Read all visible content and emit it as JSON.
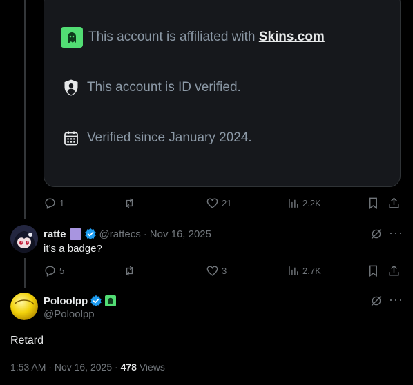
{
  "affiliation_card": {
    "affiliated_text": "This account is affiliated with",
    "affiliated_link": "Skins.com",
    "id_verified_text": "This account is ID verified.",
    "verified_since_text": "Verified since January 2024."
  },
  "post1_actions": {
    "replies": "1",
    "likes": "21",
    "views": "2.2K"
  },
  "reply": {
    "name": "ratte",
    "handle": "@rattecs",
    "separator": "·",
    "date": "Nov 16, 2025",
    "text": "it’s a badge?",
    "actions": {
      "replies": "5",
      "likes": "3",
      "views": "2.7K"
    }
  },
  "main_post": {
    "name": "Poloolpp",
    "handle": "@Poloolpp",
    "text": "Retard",
    "time": "1:53 AM",
    "separator": "·",
    "date": "Nov 16, 2025",
    "views_count": "478",
    "views_label": "Views"
  },
  "colors": {
    "background": "#000000",
    "verified_blue": "#1d9bf0",
    "affiliate_green": "#52dd74",
    "muted": "#71767b",
    "badge_purple": "#a895e0"
  },
  "icons": {
    "affiliate": "ghost-icon",
    "id_verified": "shield-person-icon",
    "calendar": "calendar-icon",
    "reply": "reply-icon",
    "repost": "repost-icon",
    "like": "heart-icon",
    "views": "views-icon",
    "bookmark": "bookmark-icon",
    "share": "share-icon",
    "grok": "grok-icon",
    "more": "more-icon"
  }
}
